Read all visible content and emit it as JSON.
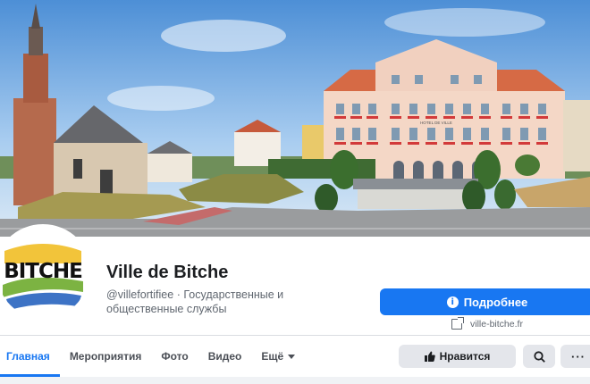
{
  "page": {
    "name": "Ville de Bitche",
    "handle": "@villefortifiee",
    "category": "Государственные и общественные службы",
    "separator": "·"
  },
  "cover": {
    "building_sign": "HOTEL DE VILLE"
  },
  "avatar": {
    "logo_text": "BITCHE",
    "colors": {
      "yellow": "#f2c43a",
      "green": "#7cb342",
      "blue": "#3d73c5"
    }
  },
  "actions": {
    "more_label": "Подробнее",
    "website": "ville-bitche.fr",
    "like_label": "Нравится",
    "more_dots": "···"
  },
  "tabs": [
    {
      "label": "Главная",
      "active": true
    },
    {
      "label": "Мероприятия"
    },
    {
      "label": "Фото"
    },
    {
      "label": "Видео"
    },
    {
      "label": "Ещё"
    }
  ],
  "colors": {
    "accent": "#1877f2",
    "button_gray": "#e4e6eb"
  }
}
